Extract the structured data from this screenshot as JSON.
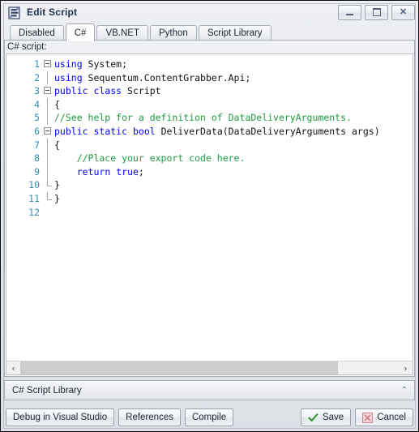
{
  "window": {
    "title": "Edit Script",
    "icon": "script-window-icon",
    "controls": {
      "minimize": "Minimize",
      "maximize": "Maximize",
      "close": "Close"
    }
  },
  "tabs": [
    {
      "label": "Disabled",
      "selected": false
    },
    {
      "label": "C#",
      "selected": true
    },
    {
      "label": "VB.NET",
      "selected": false
    },
    {
      "label": "Python",
      "selected": false
    },
    {
      "label": "Script Library",
      "selected": false
    }
  ],
  "editor": {
    "caption": "C# script:",
    "line_numbers": [
      "1",
      "2",
      "3",
      "4",
      "5",
      "6",
      "7",
      "8",
      "9",
      "10",
      "11",
      "12"
    ],
    "lines": [
      {
        "n": 1,
        "fold": "open",
        "indent": 0,
        "tokens": [
          {
            "t": "using",
            "c": "kw"
          },
          {
            "t": " System;",
            "c": "id"
          }
        ]
      },
      {
        "n": 2,
        "fold": "line",
        "indent": 0,
        "tokens": [
          {
            "t": "using",
            "c": "kw"
          },
          {
            "t": " Sequentum.ContentGrabber.Api;",
            "c": "id"
          }
        ]
      },
      {
        "n": 3,
        "fold": "open",
        "indent": 0,
        "tokens": [
          {
            "t": "public",
            "c": "kw"
          },
          {
            "t": " ",
            "c": "id"
          },
          {
            "t": "class",
            "c": "kw"
          },
          {
            "t": " Script",
            "c": "id"
          }
        ]
      },
      {
        "n": 4,
        "fold": "line",
        "indent": 0,
        "tokens": [
          {
            "t": "{",
            "c": "id"
          }
        ]
      },
      {
        "n": 5,
        "fold": "line",
        "indent": 0,
        "tokens": [
          {
            "t": "//See help for a definition of DataDeliveryArguments.",
            "c": "cmt"
          }
        ]
      },
      {
        "n": 6,
        "fold": "open",
        "indent": 0,
        "tokens": [
          {
            "t": "public",
            "c": "kw"
          },
          {
            "t": " ",
            "c": "id"
          },
          {
            "t": "static",
            "c": "kw"
          },
          {
            "t": " ",
            "c": "id"
          },
          {
            "t": "bool",
            "c": "kw"
          },
          {
            "t": " DeliverData(DataDeliveryArguments args)",
            "c": "id"
          }
        ]
      },
      {
        "n": 7,
        "fold": "line",
        "indent": 0,
        "tokens": [
          {
            "t": "{",
            "c": "id"
          }
        ]
      },
      {
        "n": 8,
        "fold": "line",
        "indent": 0,
        "tokens": [
          {
            "t": "    //Place your export code here.",
            "c": "cmt"
          }
        ]
      },
      {
        "n": 9,
        "fold": "line",
        "indent": 0,
        "tokens": [
          {
            "t": "    ",
            "c": "id"
          },
          {
            "t": "return",
            "c": "kw"
          },
          {
            "t": " ",
            "c": "id"
          },
          {
            "t": "true",
            "c": "kw"
          },
          {
            "t": ";",
            "c": "id"
          }
        ]
      },
      {
        "n": 10,
        "fold": "end",
        "indent": 0,
        "tokens": [
          {
            "t": "}",
            "c": "id"
          }
        ]
      },
      {
        "n": 11,
        "fold": "end",
        "indent": 0,
        "tokens": [
          {
            "t": "}",
            "c": "id"
          }
        ]
      },
      {
        "n": 12,
        "fold": "none",
        "indent": 0,
        "tokens": [
          {
            "t": "",
            "c": "id"
          }
        ]
      }
    ],
    "scrollbar": {
      "left_arrow": "‹",
      "right_arrow": "›",
      "thumb_percent": 84
    }
  },
  "library": {
    "label": "C# Script Library",
    "chevron": "collapse-chevron-icon",
    "chevron_glyph": "⌃"
  },
  "footer": {
    "buttons": [
      {
        "label": "Debug in Visual Studio",
        "icon": null
      },
      {
        "label": "References",
        "icon": null
      },
      {
        "label": "Compile",
        "icon": null
      }
    ],
    "save": {
      "label": "Save",
      "icon": "checkmark-icon",
      "color": "#3a9a3a"
    },
    "cancel": {
      "label": "Cancel",
      "icon": "close-x-icon",
      "color": "#e8868f"
    }
  },
  "colors": {
    "keyword": "#0000ff",
    "comment": "#1f9b40",
    "line_number": "#2b91af",
    "identifier": "#111111",
    "title_text": "#20304d"
  }
}
